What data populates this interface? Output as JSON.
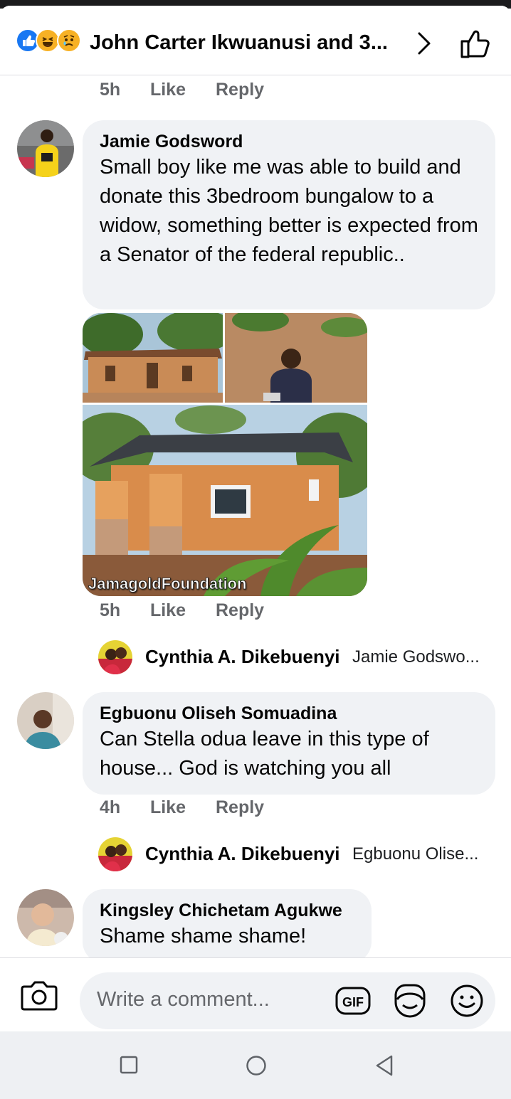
{
  "header": {
    "reactions": [
      "like-reaction",
      "haha-reaction",
      "sad-reaction"
    ],
    "title": "John Carter Ikwuanusi and 3..."
  },
  "top_actions": {
    "time": "5h",
    "like": "Like",
    "reply": "Reply"
  },
  "comments": [
    {
      "author": "Jamie Godsword",
      "text": "Small boy like me was able to build and donate this 3bedroom bungalow to a widow, something better is expected from a Senator of the federal republic..",
      "photo_label": "JamagoldFoundation",
      "time": "5h",
      "like": "Like",
      "reply": "Reply",
      "reply_preview": {
        "author": "Cynthia A. Dikebuenyi",
        "text": "Jamie Godswo..."
      }
    },
    {
      "author": "Egbuonu Oliseh Somuadina",
      "text": "Can Stella odua leave in this type of house... God is watching you all",
      "time": "4h",
      "like": "Like",
      "reply": "Reply",
      "reply_preview": {
        "author": "Cynthia A. Dikebuenyi",
        "text": "Egbuonu Olise..."
      }
    },
    {
      "author": "Kingsley Chichetam Agukwe",
      "text": "Shame shame shame!"
    }
  ],
  "composer": {
    "placeholder": "Write a comment...",
    "gif_label": "GIF"
  },
  "colors": {
    "accent": "#1877f2",
    "bubble": "#f0f2f5",
    "meta": "#65676b",
    "reaction_yellow": "#f7b125"
  },
  "icons": [
    "chevron-right-icon",
    "thumbs-up-icon",
    "camera-icon",
    "gif-icon",
    "sticker-icon",
    "emoji-icon",
    "recents-icon",
    "home-icon",
    "back-icon"
  ]
}
